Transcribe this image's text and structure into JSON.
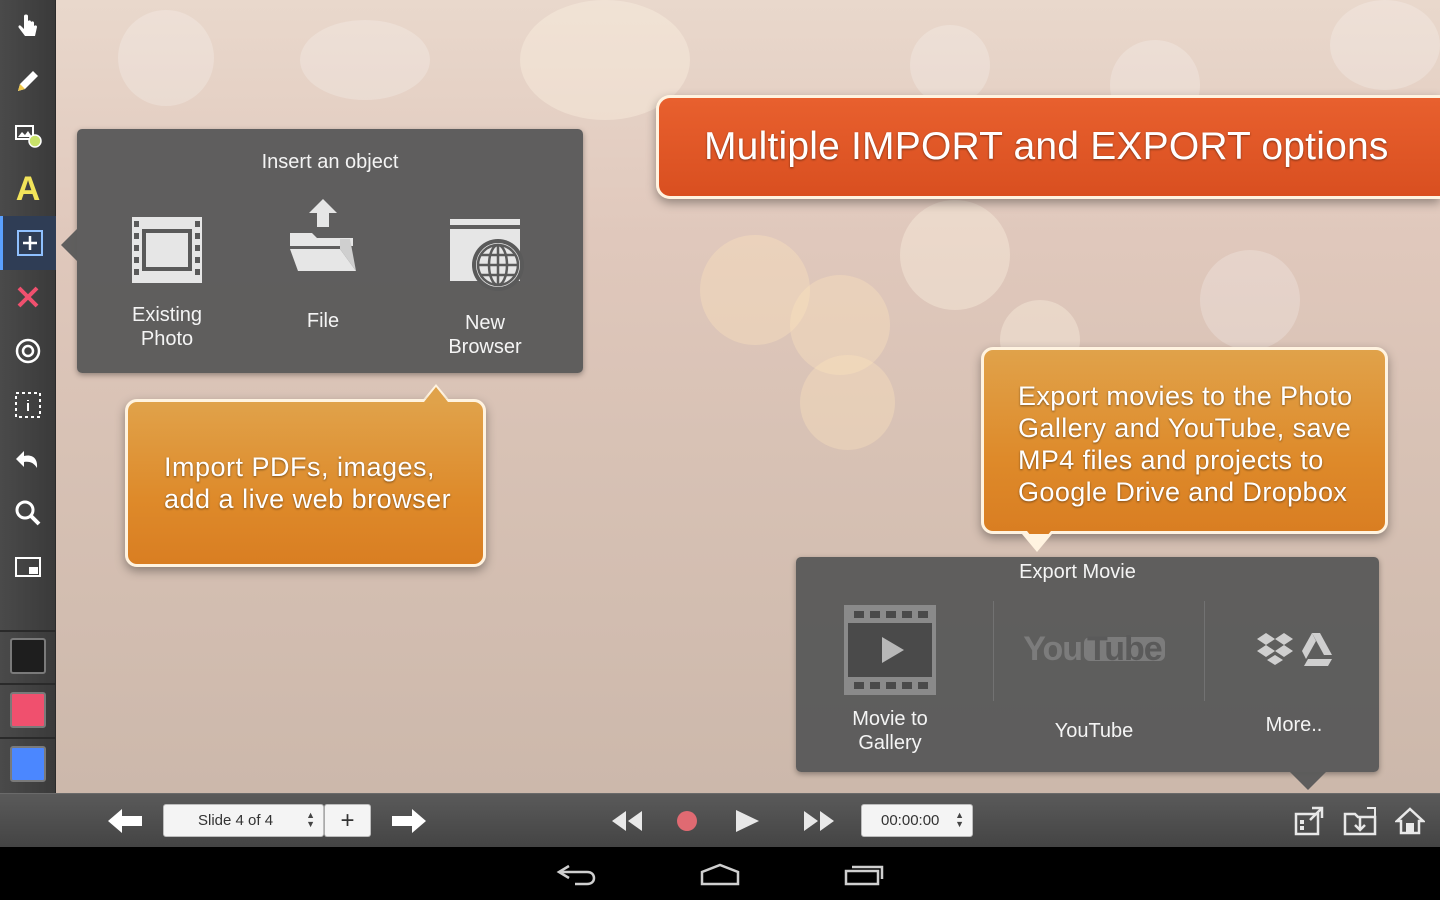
{
  "insert_panel": {
    "title": "Insert an object",
    "options": [
      {
        "label_line1": "Existing",
        "label_line2": "Photo",
        "icon": "film-frame-icon"
      },
      {
        "label_line1": "File",
        "label_line2": "",
        "icon": "folder-upload-icon"
      },
      {
        "label_line1": "New",
        "label_line2": "Browser",
        "icon": "globe-window-icon"
      }
    ]
  },
  "callouts": {
    "headline": "Multiple IMPORT and EXPORT options",
    "import_line1": "Import PDFs, images,",
    "import_line2": "add a live web browser",
    "export_line1": "Export movies to the Photo",
    "export_line2": "Gallery and YouTube, save",
    "export_line3": "MP4 files and projects to",
    "export_line4": "Google Drive and Dropbox"
  },
  "export_panel": {
    "title": "Export Movie",
    "options": [
      {
        "label_line1": "Movie to",
        "label_line2": "Gallery",
        "icon": "film-play-icon"
      },
      {
        "label_line1": "YouTube",
        "label_line2": "",
        "icon": "youtube-logo",
        "logo_you": "You",
        "logo_tube": "Tube"
      },
      {
        "label_line1": "More..",
        "label_line2": "",
        "icon": "dropbox-drive-icon"
      }
    ]
  },
  "bottom_bar": {
    "slide_label": "Slide 4 of 4",
    "add_label": "+",
    "time_value": "00:00:00"
  },
  "toolbar": {
    "text_tool_label": "A",
    "colors": {
      "black": "#1e1e1e",
      "red": "#f0506e",
      "blue": "#4b87ff"
    }
  },
  "colors": {
    "accent_orange": "#de8a2a",
    "headline_red": "#d94f20",
    "panel_gray": "#5a5a5a",
    "active_tool_blue": "#5aa0ff"
  }
}
